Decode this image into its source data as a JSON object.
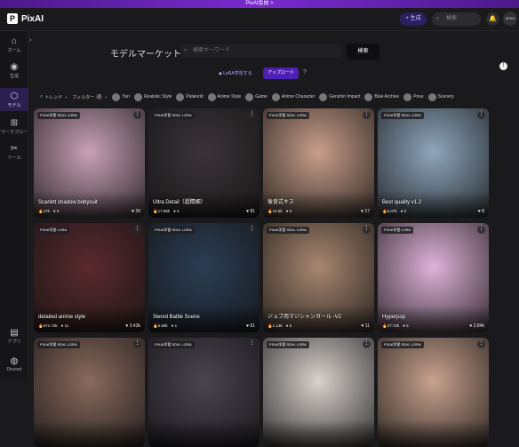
{
  "promo": {
    "label": "PixAI会員 >"
  },
  "header": {
    "logo": "PixAI",
    "generate_label": "+ 生成",
    "search_placeholder": "検索",
    "avatar_text": "ZEKH"
  },
  "sidebar": {
    "items": [
      {
        "label": "ホーム",
        "icon": "home-icon"
      },
      {
        "label": "生成",
        "icon": "palette-icon"
      },
      {
        "label": "モデル",
        "icon": "model-icon"
      },
      {
        "label": "ワークフロー",
        "icon": "workflow-icon"
      },
      {
        "label": "ツール",
        "icon": "tool-icon"
      },
      {
        "label": "アプリ",
        "icon": "app-icon"
      },
      {
        "label": "Discord",
        "icon": "discord-icon"
      }
    ]
  },
  "main": {
    "title": "モデルマーケット",
    "search_placeholder": "検索キーワード",
    "search_button": "検索",
    "lora_link": "LoRA学習する",
    "upload_button": "アップロード"
  },
  "filters": {
    "trend": "トレンド",
    "filter": "フィルター",
    "filter_count": "2",
    "tags": [
      "Yuri",
      "Realistic Style",
      "Palworld",
      "Anime Style",
      "Game",
      "Anime Character",
      "Genshin Impact",
      "Blue Archive",
      "Pose",
      "Scenery"
    ]
  },
  "cards": [
    {
      "badge": "PIXAI学習 SDXL LORA",
      "name": "Scarlett shadow bobysuit",
      "runs": "47k",
      "comments": "0",
      "likes": "30",
      "color": "#c9a1b5"
    },
    {
      "badge": "PIXAI学習 SDXL LORA",
      "name": "Ultra Detail（超精細）",
      "runs": "17.86k",
      "comments": "5",
      "likes": "81",
      "color": "#3a3438"
    },
    {
      "badge": "PIXAI学習 SDXL LORA",
      "name": "後背式キス",
      "runs": "12.5k",
      "comments": "0",
      "likes": "17",
      "color": "#c99e8a"
    },
    {
      "badge": "PIXAI学習 SDXL LORA",
      "name": "Best quality v1.2",
      "runs": "5.07k",
      "comments": "0",
      "likes": "8",
      "color": "#8fa6bc"
    },
    {
      "badge": "PIXAI学習 LORA",
      "name": "detailed anime style",
      "runs": "671.73k",
      "comments": "11",
      "likes": "3.43k",
      "color": "#5a2a2e"
    },
    {
      "badge": "PIXAI学習 SDXL LORA",
      "name": "Sword Battle Scene",
      "runs": "5.58k",
      "comments": "1",
      "likes": "61",
      "color": "#2c3e54"
    },
    {
      "badge": "PIXAI学習 SDXL LORA",
      "name": "ジョブ用マジシャンガール -V2",
      "runs": "1.13k",
      "comments": "0",
      "likes": "11",
      "color": "#a88770"
    },
    {
      "badge": "PIXAI学習 LORA",
      "name": "Hyperpop",
      "runs": "27.72k",
      "comments": "5",
      "likes": "2.84k",
      "color": "#e0b3d8"
    },
    {
      "badge": "PIXAI学習 SDXL LORA",
      "name": "",
      "runs": "",
      "comments": "",
      "likes": "",
      "color": "#8a6a5e"
    },
    {
      "badge": "PIXAI学習 SDXL LORA",
      "name": "",
      "runs": "",
      "comments": "",
      "likes": "",
      "color": "#4a4450"
    },
    {
      "badge": "PIXAI学習 SDXL LORA",
      "name": "",
      "runs": "",
      "comments": "",
      "likes": "",
      "color": "#d8d2ce"
    },
    {
      "badge": "PIXAI学習 SDXL LORA",
      "name": "",
      "runs": "",
      "comments": "",
      "likes": "",
      "color": "#c9a28e"
    }
  ]
}
